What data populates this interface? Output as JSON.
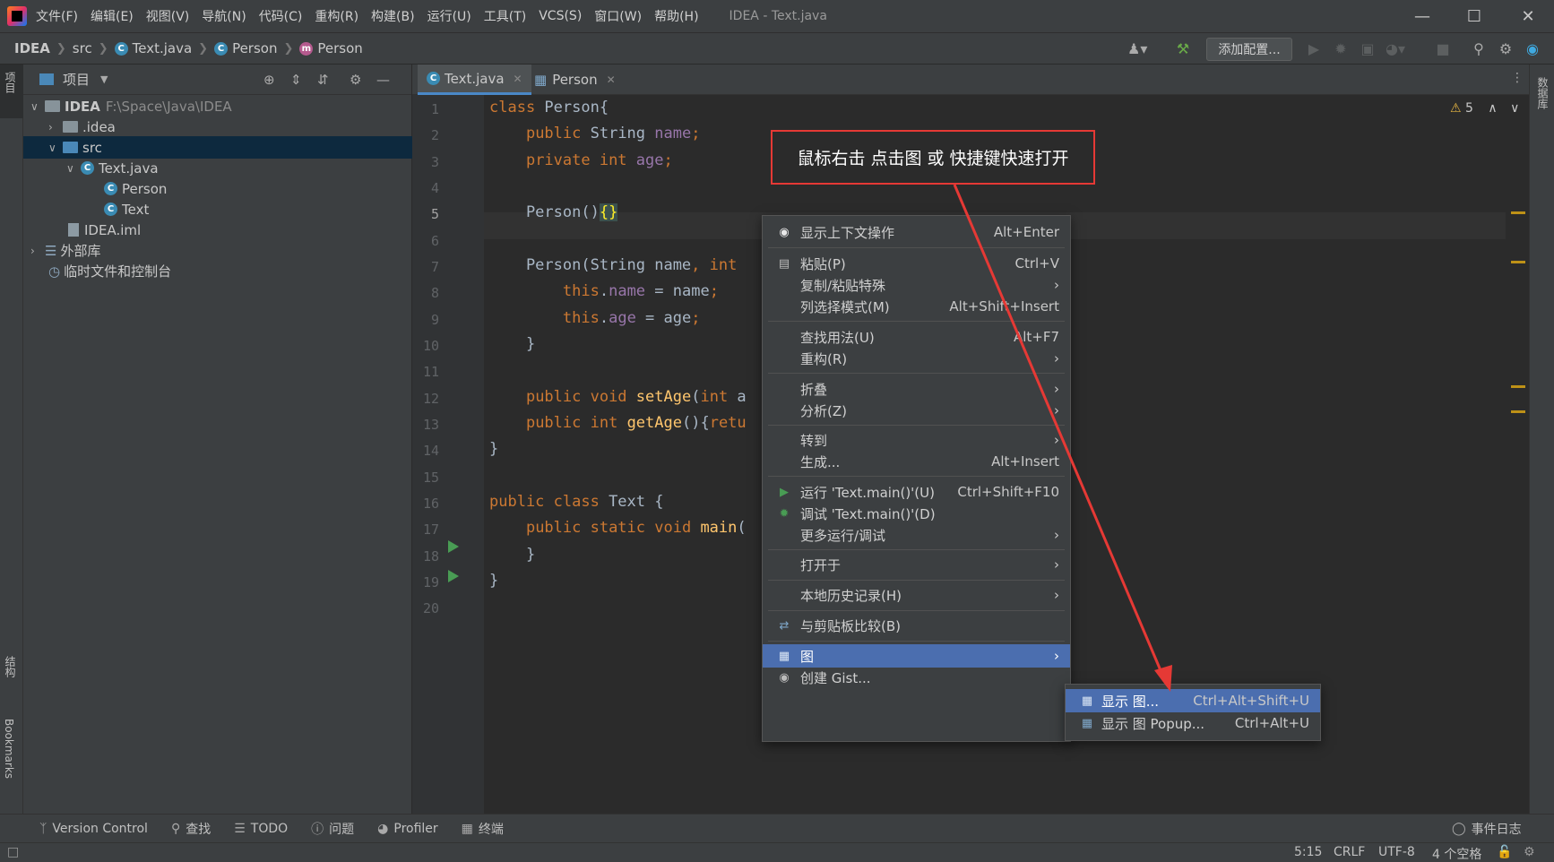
{
  "window": {
    "title": "IDEA - Text.java"
  },
  "menubar": [
    "文件(F)",
    "编辑(E)",
    "视图(V)",
    "导航(N)",
    "代码(C)",
    "重构(R)",
    "构建(B)",
    "运行(U)",
    "工具(T)",
    "VCS(S)",
    "窗口(W)",
    "帮助(H)"
  ],
  "breadcrumb": {
    "project": "IDEA",
    "folder": "src",
    "file": "Text.java",
    "class": "Person",
    "method": "Person"
  },
  "toolbar": {
    "add_config": "添加配置..."
  },
  "left_stripe": {
    "project": "项目",
    "structure": "结构",
    "bookmarks": "Bookmarks"
  },
  "right_stripe": {
    "database": "数据库"
  },
  "project_panel": {
    "title": "项目",
    "tree": [
      {
        "label": "IDEA",
        "path": "F:\\Space\\Java\\IDEA"
      },
      {
        "label": ".idea"
      },
      {
        "label": "src"
      },
      {
        "label": "Text.java"
      },
      {
        "label": "Person"
      },
      {
        "label": "Text"
      },
      {
        "label": "IDEA.iml"
      },
      {
        "label": "外部库"
      },
      {
        "label": "临时文件和控制台"
      }
    ]
  },
  "editor": {
    "tabs": [
      {
        "label": "Text.java"
      },
      {
        "label": "Person"
      }
    ],
    "line_numbers": [
      "1",
      "2",
      "3",
      "4",
      "5",
      "6",
      "7",
      "8",
      "9",
      "10",
      "11",
      "12",
      "13",
      "14",
      "15",
      "16",
      "17",
      "18",
      "19",
      "20"
    ],
    "warnings": "5"
  },
  "annotation": "鼠标右击 点击图 或 快捷键快速打开",
  "context_menu": [
    {
      "label": "显示上下文操作",
      "shortcut": "Alt+Enter"
    },
    {
      "label": "粘贴(P)",
      "shortcut": "Ctrl+V"
    },
    {
      "label": "复制/粘贴特殊",
      "shortcut": ""
    },
    {
      "label": "列选择模式(M)",
      "shortcut": "Alt+Shift+Insert"
    },
    {
      "label": "查找用法(U)",
      "shortcut": "Alt+F7"
    },
    {
      "label": "重构(R)",
      "shortcut": ""
    },
    {
      "label": "折叠",
      "shortcut": ""
    },
    {
      "label": "分析(Z)",
      "shortcut": ""
    },
    {
      "label": "转到",
      "shortcut": ""
    },
    {
      "label": "生成...",
      "shortcut": "Alt+Insert"
    },
    {
      "label": "运行 'Text.main()'(U)",
      "shortcut": "Ctrl+Shift+F10"
    },
    {
      "label": "调试 'Text.main()'(D)",
      "shortcut": ""
    },
    {
      "label": "更多运行/调试",
      "shortcut": ""
    },
    {
      "label": "打开于",
      "shortcut": ""
    },
    {
      "label": "本地历史记录(H)",
      "shortcut": ""
    },
    {
      "label": "与剪贴板比较(B)",
      "shortcut": ""
    },
    {
      "label": "图",
      "shortcut": ""
    },
    {
      "label": "创建 Gist...",
      "shortcut": ""
    }
  ],
  "submenu": [
    {
      "label": "显示 图...",
      "shortcut": "Ctrl+Alt+Shift+U"
    },
    {
      "label": "显示 图 Popup...",
      "shortcut": "Ctrl+Alt+U"
    }
  ],
  "bottom_tools": [
    "Version Control",
    "查找",
    "TODO",
    "问题",
    "Profiler",
    "终端"
  ],
  "event_log": "事件日志",
  "status": {
    "position": "5:15",
    "line_sep": "CRLF",
    "encoding": "UTF-8",
    "indent": "4 个空格"
  },
  "colors": {
    "accent": "#4b6eaf",
    "annotation_border": "#e53935",
    "keyword": "#cc7832",
    "field": "#9876aa"
  }
}
